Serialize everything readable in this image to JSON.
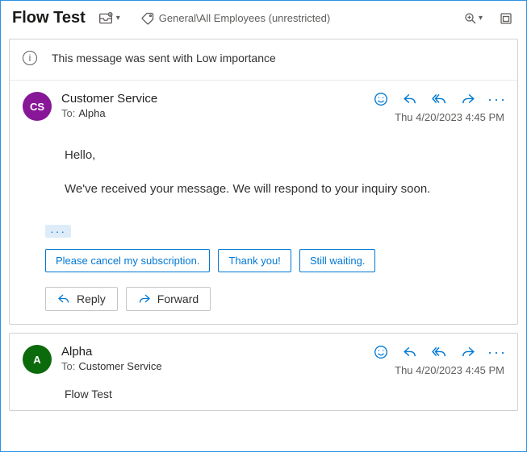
{
  "header": {
    "title": "Flow Test",
    "tag_label": "General\\All Employees (unrestricted)"
  },
  "notice": {
    "text": "This message was sent with Low importance"
  },
  "messages": [
    {
      "avatar_initials": "CS",
      "sender": "Customer Service",
      "to_label": "To:",
      "to_value": "Alpha",
      "timestamp": "Thu 4/20/2023 4:45 PM",
      "greeting": "Hello,",
      "body": "We've received your message. We will respond to your inquiry soon."
    },
    {
      "avatar_initials": "A",
      "sender": "Alpha",
      "to_label": "To:",
      "to_value": "Customer Service",
      "timestamp": "Thu 4/20/2023 4:45 PM",
      "body": "Flow Test"
    }
  ],
  "suggested_replies": [
    "Please cancel my subscription.",
    "Thank you!",
    "Still waiting."
  ],
  "reply_forward": {
    "reply": "Reply",
    "forward": "Forward"
  }
}
